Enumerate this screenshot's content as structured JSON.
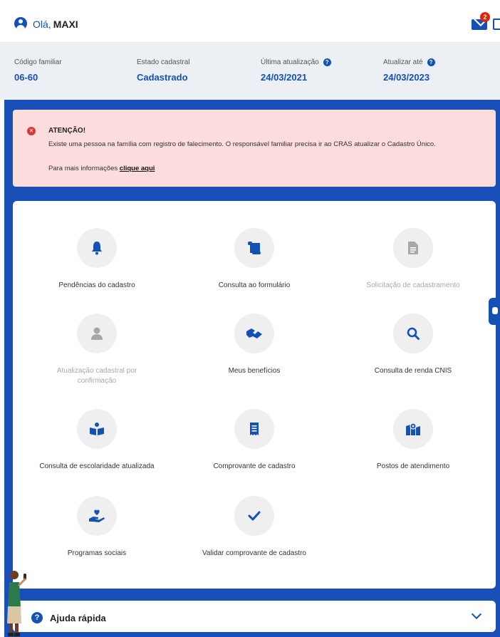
{
  "header": {
    "greeting": "Olá,",
    "user_name": "MAXI",
    "mail_badge": "2"
  },
  "info": [
    {
      "label": "Código familiar",
      "value": "06-60",
      "has_help": false
    },
    {
      "label": "Estado cadastral",
      "value": "Cadastrado",
      "has_help": false
    },
    {
      "label": "Última atualização",
      "value": "24/03/2021",
      "has_help": true
    },
    {
      "label": "Atualizar até",
      "value": "24/03/2023",
      "has_help": true
    }
  ],
  "alert": {
    "title": "ATENÇÃO!",
    "message": "Existe uma pessoa na família com registro de falecimento. O responsável familiar precisa ir ao CRAS atualizar o Cadastro Único.",
    "more_prefix": "Para mais informações",
    "more_link": "clique aqui"
  },
  "services": [
    {
      "label": "Pendências do cadastro",
      "icon": "bell-icon",
      "enabled": true
    },
    {
      "label": "Consulta ao formulário",
      "icon": "scroll-icon",
      "enabled": true
    },
    {
      "label": "Solicitação de cadastramento",
      "icon": "document-icon",
      "enabled": false
    },
    {
      "label": "Atualização cadastral por confirmação",
      "icon": "user-icon",
      "enabled": false
    },
    {
      "label": "Meus benefícios",
      "icon": "handshake-icon",
      "enabled": true
    },
    {
      "label": "Consulta de renda CNIS",
      "icon": "search-icon",
      "enabled": true
    },
    {
      "label": "Consulta de escolaridade atualizada",
      "icon": "book-reader-icon",
      "enabled": true
    },
    {
      "label": "Comprovante de cadastro",
      "icon": "receipt-icon",
      "enabled": true
    },
    {
      "label": "Postos de atendimento",
      "icon": "map-marker-icon",
      "enabled": true
    },
    {
      "label": "Programas sociais",
      "icon": "hand-heart-icon",
      "enabled": true
    },
    {
      "label": "Validar comprovante de cadastro",
      "icon": "check-icon",
      "enabled": true
    }
  ],
  "help": {
    "label": "Ajuda rápida"
  },
  "colors": {
    "primary": "#1351b4",
    "background_blue": "#1a4fb8",
    "alert_bg": "#fcdcdc",
    "alert_icon": "#d83933"
  }
}
